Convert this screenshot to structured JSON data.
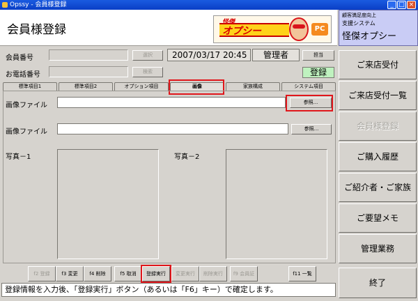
{
  "window": {
    "title": "Opssy - 会員様登録",
    "min": "_",
    "max": "□",
    "close": "×"
  },
  "header": {
    "title": "会員様登録",
    "logo_small": "怪傑",
    "logo_name": "オプシー",
    "logo_pc": "PC"
  },
  "info": {
    "line1": "顧客満足度向上",
    "line2": "支援システム",
    "line3": "怪傑オプシー"
  },
  "fields": {
    "member_no_label": "会員番号",
    "phone_label": "お電話番号",
    "select_btn": "選択",
    "search_btn": "検索",
    "datetime": "2007/03/17 20:45",
    "role": "管理者",
    "staff_btn": "担当",
    "status": "登録"
  },
  "tabs": [
    {
      "label": "標準項目1"
    },
    {
      "label": "標準項目2"
    },
    {
      "label": "オプション項目"
    },
    {
      "label": "画像"
    },
    {
      "label": "家族構成"
    },
    {
      "label": "システム項目"
    }
  ],
  "image_tab": {
    "file_label_1": "画像ファイル",
    "file_label_2": "画像ファイル",
    "browse_1": "参照...",
    "browse_2": "参照...",
    "photo1": "写真－1",
    "photo2": "写真－2"
  },
  "nav": [
    {
      "label": "ご来店受付",
      "enabled": true
    },
    {
      "label": "ご来店受付一覧",
      "enabled": true
    },
    {
      "label": "会員様登録",
      "enabled": false
    },
    {
      "label": "ご購入履歴",
      "enabled": true
    },
    {
      "label": "ご紹介者・ご家族",
      "enabled": true
    },
    {
      "label": "ご要望メモ",
      "enabled": true
    },
    {
      "label": "管理業務",
      "enabled": true
    },
    {
      "label": "終了",
      "enabled": true
    }
  ],
  "fkeys": [
    {
      "label": "f2 登録"
    },
    {
      "label": "f3 変更"
    },
    {
      "label": "f4 削除"
    },
    {
      "label": "f5 取消"
    },
    {
      "label": "登録実行"
    },
    {
      "label": "変更実行"
    },
    {
      "label": "削除実行"
    },
    {
      "label": "f9 会員証"
    },
    {
      "label": "f11 一覧"
    }
  ],
  "status_message": "登録情報を入力後、「登録実行」ボタン（あるいは「F6」キー）で確定します。"
}
